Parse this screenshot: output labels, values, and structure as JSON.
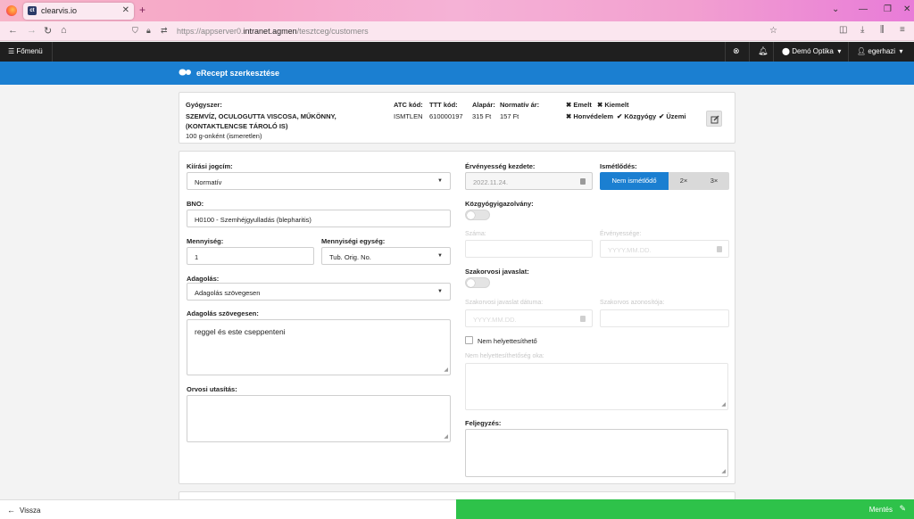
{
  "browser": {
    "tab_title": "clearvis.io",
    "tab_icon": "ct-logo-icon",
    "url_prefix": "https://appserver0.",
    "url_domain": "intranet.agmen",
    "url_path": "/tesztceg/customers"
  },
  "appbar": {
    "menu_label": "Főmenü",
    "location": "Demó Optika",
    "user": "egerhazi"
  },
  "header": {
    "title": "eRecept szerkesztése"
  },
  "drug": {
    "label_gyogyszer": "Gyógyszer:",
    "name_line1": "SZEMVÍZ, OCULOGUTTA VISCOSA, MŰKÖNNY,",
    "name_line2": "(KONTAKTLENCSE TÁROLÓ IS)",
    "name_line3": "100 g-onként (ismeretlen)",
    "label_atc": "ATC kód:",
    "atc": "ISMTLEN",
    "label_ttt": "TTT kód:",
    "ttt": "610000197",
    "label_alapar": "Alapár:",
    "alapar": "315 Ft",
    "label_normativ": "Normatív ár:",
    "normativ": "157 Ft",
    "flags": {
      "emelt": "Emelt",
      "kiemelt": "Kiemelt",
      "honvedelem": "Honvédelem",
      "kozgyogy": "Közgyógy",
      "uzemi": "Üzemi"
    }
  },
  "form": {
    "kiirasi_label": "Kiírási jogcím:",
    "kiirasi_value": "Normatív",
    "bno_label": "BNO:",
    "bno_value": "H0100 - Szemhéjgyulladás (blepharitis)",
    "mennyiseg_label": "Mennyiség:",
    "mennyiseg_value": "1",
    "egyseg_label": "Mennyiségi egység:",
    "egyseg_value": "Tub. Orig. No.",
    "adagolas_label": "Adagolás:",
    "adagolas_value": "Adagolás szövegesen",
    "adagolas_szoveg_label": "Adagolás szövegesen:",
    "adagolas_szoveg_value": "reggel és este cseppenteni",
    "orvosi_label": "Orvosi utasítás:",
    "ervenyesseg_kezdete_label": "Érvényesség kezdete:",
    "ervenyesseg_kezdete_value": "2022.11.24.",
    "ismetlodes_label": "Ismétlődés:",
    "ismetlodes_options": [
      "Nem ismétlődő",
      "2×",
      "3×"
    ],
    "kozgyogy_label": "Közgyógyigazolvány:",
    "szama_label": "Száma:",
    "ervenyessege_label": "Érvényessége:",
    "ervenyessege_placeholder": "YYYY.MM.DD.",
    "szakorvosi_label": "Szakorvosi javaslat:",
    "szakorvosi_datum_label": "Szakorvosi javaslat dátuma:",
    "szakorvosi_datum_placeholder": "YYYY.MM.DD.",
    "szakorvos_azon_label": "Szakorvos azonosítója:",
    "nem_helyettesitheto_label": "Nem helyettesíthető",
    "nem_helyettesitheto_oka_label": "Nem helyettesíthetőség oka:",
    "feljegyzes_label": "Feljegyzés:"
  },
  "footer": {
    "back_label": "Vissza",
    "save_label": "Mentés"
  },
  "colors": {
    "accent_blue": "#1b7fd1",
    "save_green": "#2ec24a",
    "appbar_dark": "#1f1f1f"
  }
}
